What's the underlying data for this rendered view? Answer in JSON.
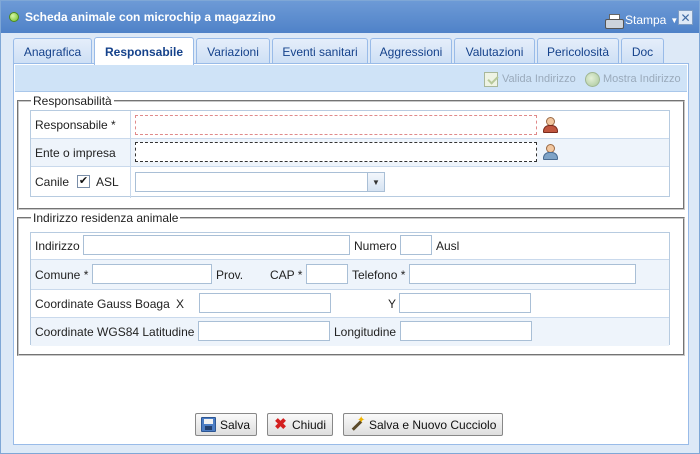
{
  "window": {
    "title": "Scheda animale con microchip a magazzino",
    "stampa_label": "Stampa",
    "close_label": "✕"
  },
  "tabs": [
    {
      "label": "Anagrafica"
    },
    {
      "label": "Responsabile"
    },
    {
      "label": "Variazioni"
    },
    {
      "label": "Eventi sanitari"
    },
    {
      "label": "Aggressioni"
    },
    {
      "label": "Valutazioni"
    },
    {
      "label": "Pericolosità"
    },
    {
      "label": "Doc"
    }
  ],
  "active_tab": "Responsabile",
  "toolbar": {
    "valida_label": "Valida Indirizzo",
    "mostra_label": "Mostra Indirizzo"
  },
  "responsabilita": {
    "legend": "Responsabilità",
    "responsabile_label": "Responsabile *",
    "responsabile_value": "",
    "ente_label": "Ente o impresa",
    "ente_value": "",
    "canile_label": "Canile",
    "canile_checked": "✔",
    "asl_label": "ASL",
    "asl_value": ""
  },
  "indirizzo": {
    "legend": "Indirizzo residenza animale",
    "indirizzo_label": "Indirizzo",
    "numero_label": "Numero",
    "ausl_label": "Ausl",
    "comune_label": "Comune *",
    "prov_label": "Prov.",
    "cap_label": "CAP *",
    "telefono_label": "Telefono *",
    "gauss_label": "Coordinate Gauss Boaga",
    "x_label": "X",
    "y_label": "Y",
    "wgs_label": "Coordinate WGS84 Latitudine",
    "longitudine_label": "Longitudine"
  },
  "buttons": {
    "salva": "Salva",
    "chiudi": "Chiudi",
    "salva_nuovo": "Salva e Nuovo Cucciolo"
  }
}
